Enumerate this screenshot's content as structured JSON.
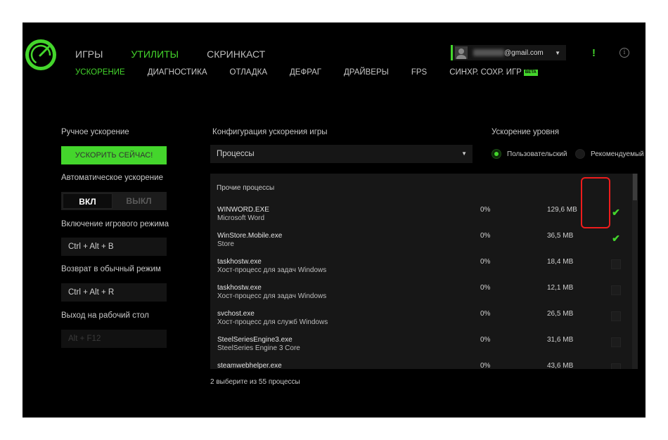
{
  "nav": {
    "top_tabs": [
      "ИГРЫ",
      "УТИЛИТЫ",
      "СКРИНКАСТ"
    ],
    "sub_tabs": [
      "УСКОРЕНИЕ",
      "ДИАГНОСТИКА",
      "ОТЛАДКА",
      "ДЕФРАГ",
      "ДРАЙВЕРЫ",
      "FPS",
      "СИНХР. СОХР. ИГР"
    ],
    "beta_badge": "BETA"
  },
  "account": {
    "email_suffix": "@gmail.com"
  },
  "left": {
    "manual_boost_label": "Ручное ускорение",
    "boost_now_button": "УСКОРИТЬ СЕЙЧАС!",
    "auto_boost_label": "Автоматическое ускорение",
    "toggle_on": "ВКЛ",
    "toggle_off": "ВЫКЛ",
    "game_mode_label": "Включение игрового режима",
    "game_mode_hotkey": "Ctrl + Alt + B",
    "normal_mode_label": "Возврат в обычный режим",
    "normal_mode_hotkey": "Ctrl + Alt + R",
    "desktop_label": "Выход на рабочий стол",
    "desktop_hotkey": "Alt + F12"
  },
  "config": {
    "title": "Конфигурация ускорения игры",
    "dropdown_value": "Процессы"
  },
  "level": {
    "title": "Ускорение уровня",
    "option_custom": "Пользовательский",
    "option_recommended": "Рекомендуемый"
  },
  "processes": {
    "header": "Прочие процессы",
    "rows": [
      {
        "name": "WINWORD.EXE",
        "desc": "Microsoft Word",
        "cpu": "0%",
        "mem": "129,6 MB",
        "checked": true
      },
      {
        "name": "WinStore.Mobile.exe",
        "desc": "Store",
        "cpu": "0%",
        "mem": "36,5 MB",
        "checked": true
      },
      {
        "name": "taskhostw.exe",
        "desc": "Хост-процесс для задач Windows",
        "cpu": "0%",
        "mem": "18,4 MB",
        "checked": false
      },
      {
        "name": "taskhostw.exe",
        "desc": "Хост-процесс для задач Windows",
        "cpu": "0%",
        "mem": "12,1 MB",
        "checked": false
      },
      {
        "name": "svchost.exe",
        "desc": "Хост-процесс для служб Windows",
        "cpu": "0%",
        "mem": "26,5 MB",
        "checked": false
      },
      {
        "name": "SteelSeriesEngine3.exe",
        "desc": "SteelSeries Engine 3 Core",
        "cpu": "0%",
        "mem": "31,6 MB",
        "checked": false
      },
      {
        "name": "steamwebhelper.exe",
        "desc": "",
        "cpu": "0%",
        "mem": "43,6 MB",
        "checked": false
      }
    ],
    "selection_summary": "2 выберите из 55 процессы"
  }
}
